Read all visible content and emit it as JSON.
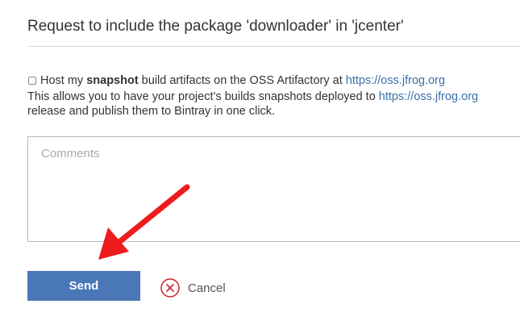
{
  "dialog": {
    "title": "Request to include the package 'downloader' in 'jcenter'"
  },
  "snapshot_option": {
    "label_before": "Host my ",
    "label_bold": "snapshot",
    "label_after": " build artifacts on the OSS Artifactory at ",
    "link_text": "https://oss.jfrog.org",
    "checked": false
  },
  "description": {
    "line1_before": "This allows you to have your project’s builds snapshots deployed to ",
    "line1_link": "https://oss.jfrog.org",
    "line2": "release and publish them to Bintray in one click."
  },
  "comments": {
    "placeholder": "Comments"
  },
  "actions": {
    "send_label": "Send",
    "cancel_label": "Cancel"
  },
  "colors": {
    "primary_button": "#4a77b8",
    "link": "#3a6fa8",
    "cancel_icon": "#d0202a",
    "annotation_arrow": "#ee1c1c"
  },
  "icons": {
    "cancel": "circle-x-icon",
    "annotation": "red-arrow-annotation"
  }
}
